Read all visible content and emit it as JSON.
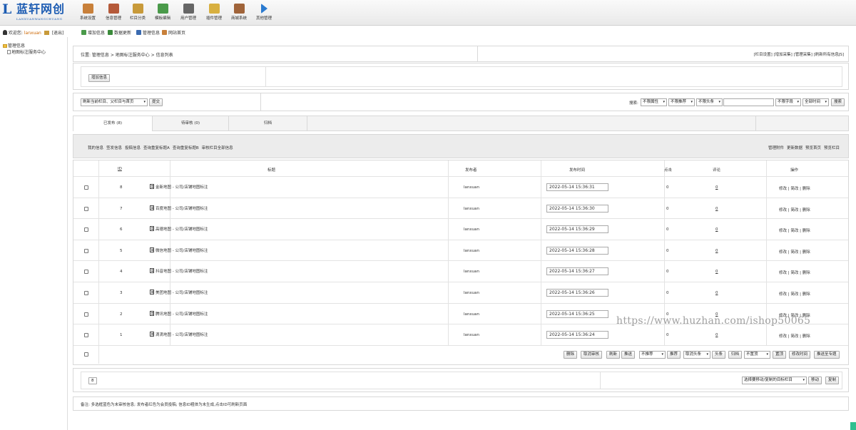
{
  "logo": {
    "mark": "L",
    "name": "蓝轩网创",
    "en": "LANXUANWANGCHUANG"
  },
  "nav": [
    {
      "label": "系统设置",
      "icon": "settings-icon",
      "color": "#c8803a"
    },
    {
      "label": "信息管理",
      "icon": "document-icon",
      "color": "#b55a3a"
    },
    {
      "label": "栏目分类",
      "icon": "category-icon",
      "color": "#c89a3a"
    },
    {
      "label": "模板编辑",
      "icon": "template-icon",
      "color": "#4a9a4a"
    },
    {
      "label": "用户管理",
      "icon": "user-icon",
      "color": "#666666"
    },
    {
      "label": "插件管理",
      "icon": "plugin-icon",
      "color": "#d8b040"
    },
    {
      "label": "商城系统",
      "icon": "shop-icon",
      "color": "#a0643a"
    },
    {
      "label": "其他管理",
      "icon": "play-icon",
      "color": "#2a7ad0"
    }
  ],
  "welcome": {
    "prefix": "欢迎您:",
    "user": "lanxuan",
    "logout": "[退出]"
  },
  "quick": [
    {
      "label": "增加信息",
      "icon": "add-icon",
      "color": "#4a9a4a"
    },
    {
      "label": "数据更新",
      "icon": "refresh-icon",
      "color": "#3a8a3a"
    },
    {
      "label": "管理信息",
      "icon": "edit-icon",
      "color": "#3a6ab0"
    },
    {
      "label": "网站首页",
      "icon": "home-icon",
      "color": "#c8803a"
    }
  ],
  "tree": {
    "root": "管理信息",
    "child": "地图标注服务中心"
  },
  "location": {
    "text": "位置: 管理信息 > 地图标注服务中心 > 信息列表",
    "links": "[栏目设置] [增加采集] [管理采集] [刷新所有信息JS]"
  },
  "add_button": "增加信息",
  "refresh": {
    "select": "刷新当前栏目、父栏目与首页",
    "submit": "提交"
  },
  "search": {
    "label": "搜索:",
    "attr": "不限属性",
    "recommend": "不限推荐",
    "headline": "不限头条",
    "field": "不限字段",
    "time": "全部时间",
    "button": "搜索"
  },
  "tabs": [
    "已发布 (8)",
    "待审核 (0)",
    "归档"
  ],
  "toolbar": {
    "left": [
      "我的信息",
      "签发信息",
      "投稿信息",
      "查询重复标题A",
      "查询重复标题B",
      "审核栏目全部信息"
    ],
    "right": [
      "管理附件",
      "更新数据",
      "预览首页",
      "预览栏目"
    ]
  },
  "table": {
    "headers": {
      "id": "ID",
      "title": "标题",
      "author": "发布者",
      "time": "发布时间",
      "clicks": "点击",
      "comments": "评论",
      "ops": "操作"
    },
    "rows": [
      {
        "id": "8",
        "title": "金新地图 - 公司/店铺地图标注",
        "author": "lanxuan",
        "time": "2022-05-14 15:36:31",
        "clicks": "0",
        "comments": "0",
        "ops": "修改 | 简改 | 删除"
      },
      {
        "id": "7",
        "title": "百度地图 - 公司/店铺地图标注",
        "author": "lanxuan",
        "time": "2022-05-14 15:36:30",
        "clicks": "0",
        "comments": "0",
        "ops": "修改 | 简改 | 删除"
      },
      {
        "id": "6",
        "title": "高德地图 - 公司/店铺地图标注",
        "author": "lanxuan",
        "time": "2022-05-14 15:36:29",
        "clicks": "0",
        "comments": "0",
        "ops": "修改 | 简改 | 删除"
      },
      {
        "id": "5",
        "title": "微信地图 - 公司/店铺地图标注",
        "author": "lanxuan",
        "time": "2022-05-14 15:36:28",
        "clicks": "0",
        "comments": "0",
        "ops": "修改 | 简改 | 删除"
      },
      {
        "id": "4",
        "title": "抖音地图 - 公司/店铺地图标注",
        "author": "lanxuan",
        "time": "2022-05-14 15:36:27",
        "clicks": "0",
        "comments": "0",
        "ops": "修改 | 简改 | 删除"
      },
      {
        "id": "3",
        "title": "美团地图 - 公司/店铺地图标注",
        "author": "lanxuan",
        "time": "2022-05-14 15:36:26",
        "clicks": "0",
        "comments": "0",
        "ops": "修改 | 简改 | 删除"
      },
      {
        "id": "2",
        "title": "腾讯地图 - 公司/店铺地图标注",
        "author": "lanxuan",
        "time": "2022-05-14 15:36:25",
        "clicks": "0",
        "comments": "0",
        "ops": "修改 | 简改 | 删除"
      },
      {
        "id": "1",
        "title": "滴滴地图 - 公司/店铺地图标注",
        "author": "lanxuan",
        "time": "2022-05-14 15:36:24",
        "clicks": "0",
        "comments": "0",
        "ops": "修改 | 简改 | 删除"
      }
    ]
  },
  "batch": {
    "delete": "删除",
    "unaudit": "取消审核",
    "refresh": "刷新",
    "push": "推送",
    "no_recommend": "不推荐",
    "recommend": "推荐",
    "cancel_headline": "取消头条",
    "headline": "头条",
    "archive": "归档",
    "no_top": "不置顶",
    "top": "置顶",
    "modify_time": "修改时间",
    "push_topic": "推送至专题"
  },
  "pager": {
    "count": "8",
    "target_select": "选择要移动/复制的目标栏目",
    "move": "移动",
    "copy": "复制"
  },
  "note": "备注: 多选框蓝色为未审核信息; 发布者红色为会员投稿; 信息ID粗体为未生成,点击ID可刷新页面",
  "watermark": "https://www.huzhan.com/ishop50065"
}
